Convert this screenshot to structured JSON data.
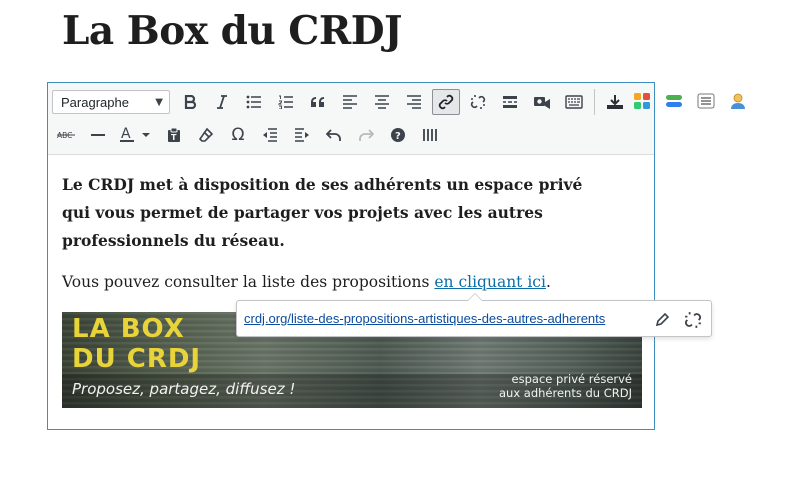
{
  "page": {
    "title": "La Box du CRDJ"
  },
  "toolbar": {
    "format_select": "Paragraphe",
    "format_arrow": "▼",
    "omega_glyph": "Ω",
    "help_glyph": "?"
  },
  "content": {
    "strong_line1": "Le CRDJ met à disposition de ses adhérents un espace privé",
    "strong_line2": "qui vous permet de partager vos projets avec les autres professionnels du réseau.",
    "text_before_link": "Vous pouvez consulter la liste des propositions ",
    "link_text": "en cliquant ici",
    "text_after_link": "."
  },
  "link_popup": {
    "url": "crdj.org/liste-des-propositions-artistiques-des-autres-adherents"
  },
  "banner": {
    "title_line1": "LA BOX",
    "title_line2": "DU CRDJ",
    "tagline": "Proposez, partagez, diffusez !",
    "note_line1": "espace privé réservé",
    "note_line2": "aux adhérents du CRDJ"
  },
  "colors": {
    "accent": "#3d8fc0",
    "link": "#0b6ea9",
    "banner_title": "#e9d33a"
  }
}
